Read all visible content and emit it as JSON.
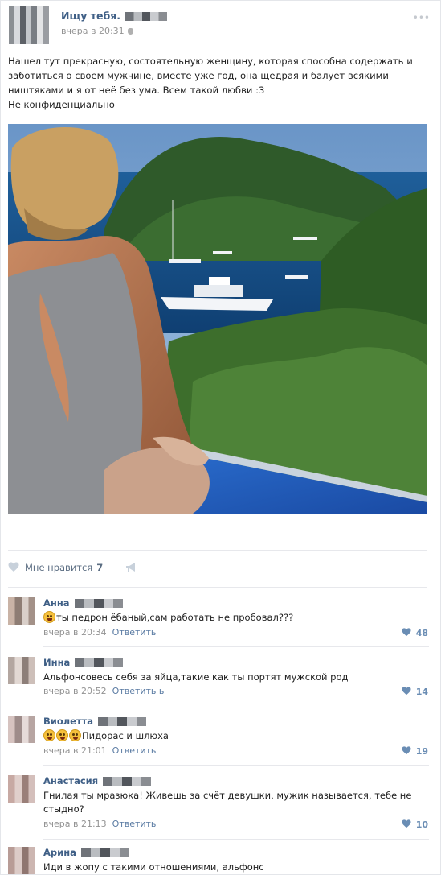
{
  "post": {
    "author": "Ищу тебя.",
    "time": "вчера в 20:31",
    "text_lines": [
      "Нашел тут прекрасную, состоятельную женщину, которая способна содержать и",
      "заботиться о своем мужчине, вместе уже год, она щедрая и балует всякими",
      "ништяками и я от неё без ума. Всем такой любви :3",
      "Не конфиденциально"
    ],
    "more_icon": "dots-icon"
  },
  "likes": {
    "label": "Мне нравится",
    "count": "7",
    "icons": [
      "heart-icon",
      "megaphone-icon"
    ]
  },
  "comments": [
    {
      "name": "Анна",
      "text": "ты педрон ёбаный,сам работать не пробовал???",
      "emoji_count": 1,
      "time": "вчера в 20:34",
      "reply": "Ответить",
      "likes": "48"
    },
    {
      "name": "Инна",
      "text": "Альфонсовесь себя за яйца,такие как ты портят мужской род",
      "emoji_count": 0,
      "time": "вчера в 20:52",
      "reply": "Ответить ь",
      "likes": "14"
    },
    {
      "name": "Виолетта",
      "text": "Пидорас и шлюха",
      "emoji_count": 3,
      "time": "вчера в 21:01",
      "reply": "Ответить",
      "likes": "19"
    },
    {
      "name": "Анастасия",
      "text": "Гнилая ты мразюка! Живешь за счёт девушки, мужик называется, тебе не стыдно?",
      "emoji_count": 0,
      "time": "вчера в 21:13",
      "reply": "Ответить",
      "likes": "10"
    },
    {
      "name": "Арина",
      "text": "Иди в жопу с такими отношениями, альфонс",
      "emoji_count": 0,
      "time": "",
      "reply": "",
      "likes": ""
    }
  ],
  "colors": {
    "link": "#3f5f86",
    "meta": "#939393",
    "like_count": "#6a8db4",
    "separator": "#e7e8ec"
  }
}
